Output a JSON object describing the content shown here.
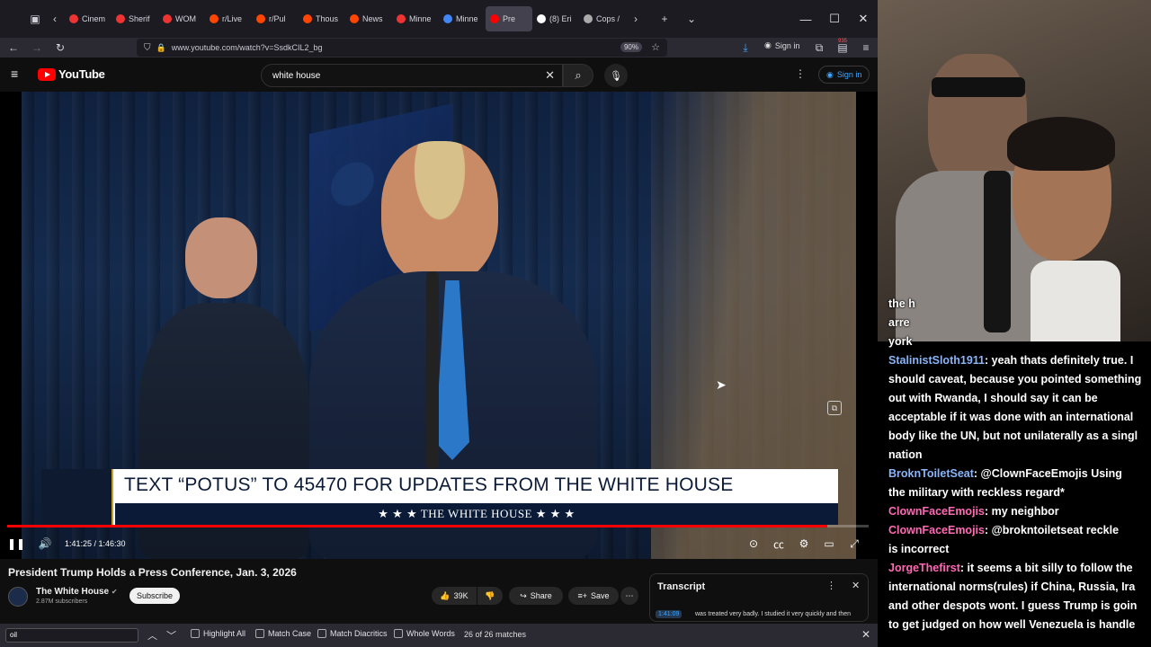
{
  "browser": {
    "tabs": [
      {
        "label": "Cinem",
        "color": "#e33"
      },
      {
        "label": "Sherif",
        "color": "#e33"
      },
      {
        "label": "WOM",
        "color": "#e33"
      },
      {
        "label": "r/Live",
        "color": "#ff4500"
      },
      {
        "label": "r/Pul",
        "color": "#ff4500"
      },
      {
        "label": "Thous",
        "color": "#ff4500"
      },
      {
        "label": "News",
        "color": "#ff4500"
      },
      {
        "label": "Minne",
        "color": "#e33"
      },
      {
        "label": "Minne",
        "color": "#4285f4"
      },
      {
        "label": "Pre",
        "color": "#f00"
      },
      {
        "label": "(8) Eri",
        "color": "#fff"
      },
      {
        "label": "Cops /",
        "color": "#aaa"
      }
    ],
    "url": "www.youtube.com/watch?v=SsdkCIL2_bg",
    "zoom": "90%",
    "signin": "Sign in",
    "badge": "935"
  },
  "youtube": {
    "logo": "YouTube",
    "search_value": "white house",
    "signin": "Sign in",
    "video": {
      "banner_text": "TEXT “POTUS” TO 45470 FOR UPDATES FROM THE WHITE HOUSE",
      "banner_sub": "★ ★ ★   THE WHITE HOUSE   ★ ★ ★",
      "time": "1:41:25 / 1:46:30",
      "progress": 0.952
    },
    "title": "President Trump Holds a Press Conference, Jan. 3, 2026",
    "channel": "The White House",
    "subscribers": "2.87M subscribers",
    "subscribe": "Subscribe",
    "likes": "39K",
    "share": "Share",
    "save": "Save",
    "transcript": {
      "title": "Transcript",
      "timestamp": "1:41:09",
      "line": "was treated very badly. I studied it very quickly and then"
    }
  },
  "findbar": {
    "query": "oil",
    "highlight_all": "Highlight All",
    "match_case": "Match Case",
    "match_diacritics": "Match Diacritics",
    "whole_words": "Whole Words",
    "matches": "26 of 26 matches"
  },
  "chat": [
    {
      "name": "",
      "text": "the h",
      "color": "#fff"
    },
    {
      "name": "",
      "text": "arre",
      "color": "#fff"
    },
    {
      "name": "",
      "text": "york",
      "color": "#fff"
    },
    {
      "name": "StalinistSloth1911",
      "text": ": yeah thats definitely true. I",
      "color": "#8ab4f8"
    },
    {
      "name": "",
      "text": "should caveat, because you pointed something",
      "color": "#fff"
    },
    {
      "name": "",
      "text": "out with Rwanda, I should say it can be",
      "color": "#fff"
    },
    {
      "name": "",
      "text": "acceptable if it was done with an international",
      "color": "#fff"
    },
    {
      "name": "",
      "text": "body like the UN, but not unilaterally as a singl",
      "color": "#fff"
    },
    {
      "name": "",
      "text": "nation",
      "color": "#fff"
    },
    {
      "name": "BroknToiletSeat",
      "text": ": @ClownFaceEmojis Using",
      "color": "#8ab4f8"
    },
    {
      "name": "",
      "text": "the military with reckless regard*",
      "color": "#fff"
    },
    {
      "name": "ClownFaceEmojis",
      "text": ": my neighbor",
      "color": "#ff69b4"
    },
    {
      "name": "ClownFaceEmojis",
      "text": ": @brokntoiletseat reckle",
      "color": "#ff69b4"
    },
    {
      "name": "",
      "text": "is incorrect",
      "color": "#fff"
    },
    {
      "name": "JorgeThefirst",
      "text": ": it seems a bit silly to follow the",
      "color": "#ff69b4"
    },
    {
      "name": "",
      "text": "international norms(rules) if China, Russia, Ira",
      "color": "#fff"
    },
    {
      "name": "",
      "text": "and other despots wont. I guess Trump is goin",
      "color": "#fff"
    },
    {
      "name": "",
      "text": "to get judged on how well Venezuela is handle",
      "color": "#fff"
    }
  ]
}
